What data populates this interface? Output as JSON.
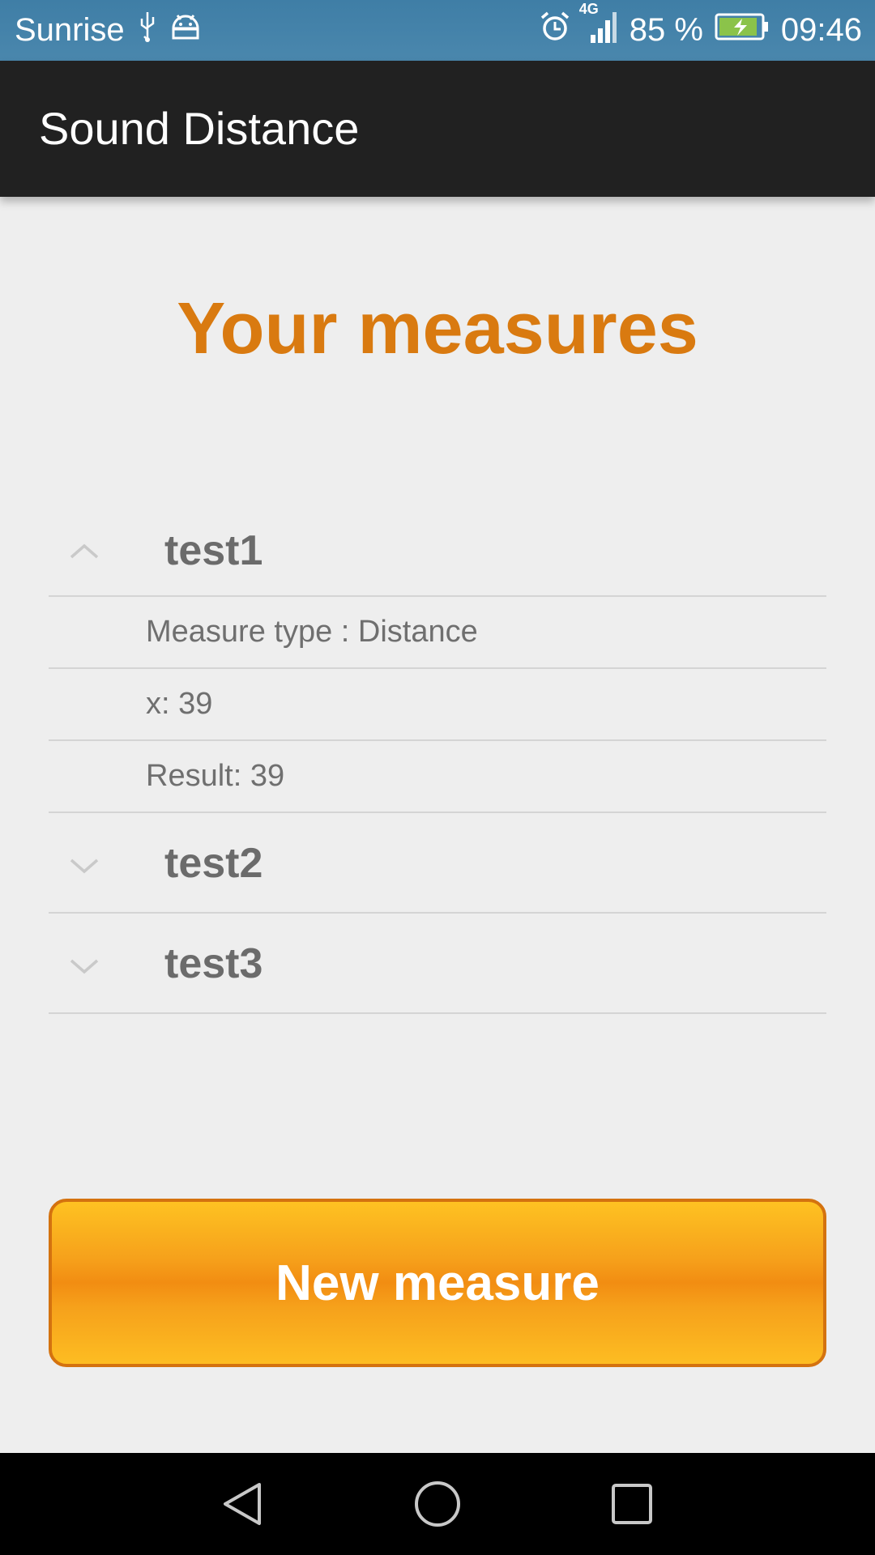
{
  "status_bar": {
    "carrier": "Sunrise",
    "network_label": "4G",
    "battery": "85 %",
    "time": "09:46"
  },
  "app_bar": {
    "title": "Sound Distance"
  },
  "main": {
    "heading": "Your measures",
    "groups": [
      {
        "title": "test1",
        "expanded": true,
        "children": [
          "Measure type : Distance",
          "x: 39",
          "Result: 39"
        ]
      },
      {
        "title": "test2",
        "expanded": false,
        "children": []
      },
      {
        "title": "test3",
        "expanded": false,
        "children": []
      }
    ],
    "new_button_label": "New measure"
  },
  "colors": {
    "status_bar": "#4682aa",
    "app_bar": "#212121",
    "heading": "#d97a10",
    "button": "#f6a11b",
    "button_border": "#d4720f",
    "battery": "#8bc34a"
  },
  "icons": {
    "usb": "usb-icon",
    "android": "android-debug-icon",
    "alarm": "alarm-icon",
    "signal": "signal-icon",
    "battery": "battery-charging-icon",
    "back": "back-icon",
    "home": "home-icon",
    "recents": "recents-icon"
  }
}
